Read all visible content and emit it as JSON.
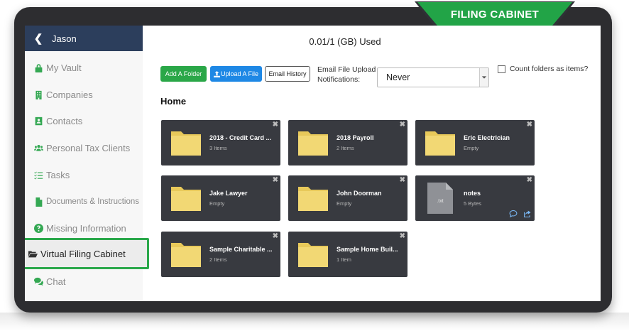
{
  "banner": {
    "title": "FILING CABINET"
  },
  "colors": {
    "accent_green": "#2aa748",
    "sidebar_header": "#2c3e5c",
    "tile_bg": "#383a40",
    "folder": "#f2d874"
  },
  "sidebar": {
    "back_icon": "chevron-left-icon",
    "user": "Jason",
    "items": [
      {
        "label": "My Vault",
        "icon": "lock-icon"
      },
      {
        "label": "Companies",
        "icon": "building-icon"
      },
      {
        "label": "Contacts",
        "icon": "contact-card-icon"
      },
      {
        "label": "Personal Tax Clients",
        "icon": "users-icon"
      },
      {
        "label": "Tasks",
        "icon": "checklist-icon"
      },
      {
        "label": "Documents & Instructions",
        "icon": "document-icon"
      },
      {
        "label": "Missing Information",
        "icon": "question-circle-icon"
      },
      {
        "label": "Virtual Filing Cabinet",
        "icon": "folder-open-icon",
        "active": true
      },
      {
        "label": "Chat",
        "icon": "chat-icon"
      }
    ]
  },
  "main": {
    "usage": "0.01/1 (GB) Used",
    "buttons": {
      "add_folder": "Add A Folder",
      "upload_file": "Upload A File",
      "email_history": "Email History"
    },
    "notifications": {
      "label": "Email File Upload Notifications:",
      "selected": "Never"
    },
    "count_folders_label": "Count folders as items?",
    "section_title": "Home",
    "tiles": [
      {
        "name": "2018 - Credit Card ...",
        "meta": "3 Items",
        "type": "folder"
      },
      {
        "name": "2018 Payroll",
        "meta": "2 Items",
        "type": "folder"
      },
      {
        "name": "Eric Electrician",
        "meta": "Empty",
        "type": "folder"
      },
      {
        "name": "Jake Lawyer",
        "meta": "Empty",
        "type": "folder"
      },
      {
        "name": "John Doorman",
        "meta": "Empty",
        "type": "folder"
      },
      {
        "name": "notes",
        "meta": "5 Bytes",
        "type": "file",
        "ext": ".txt"
      },
      {
        "name": "Sample Charitable ...",
        "meta": "2 Items",
        "type": "folder"
      },
      {
        "name": "Sample Home Buil...",
        "meta": "1 Item",
        "type": "folder"
      }
    ],
    "close_glyph": "✖"
  }
}
